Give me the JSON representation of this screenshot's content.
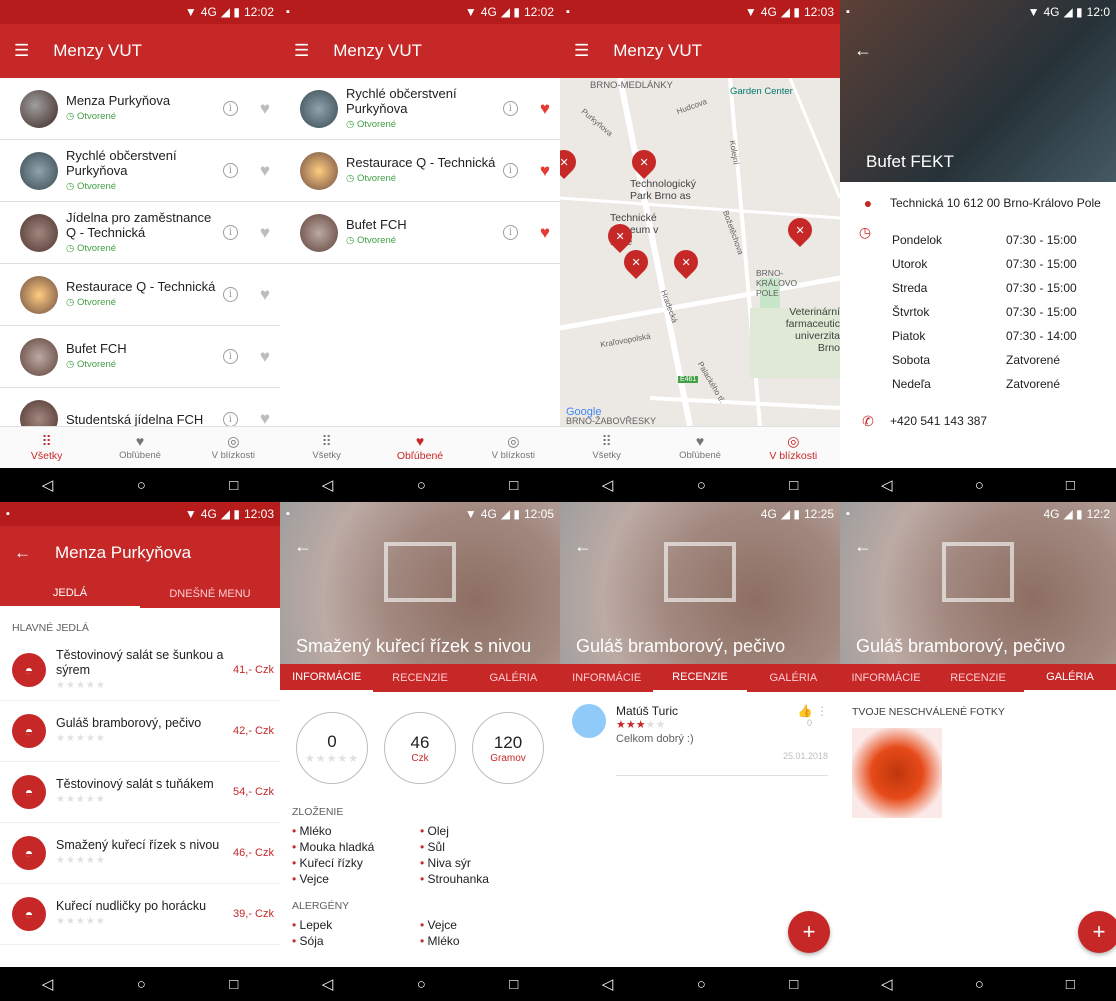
{
  "status": {
    "time1": "12:02",
    "time2": "12:02",
    "time3": "12:03",
    "time4": "12:0",
    "time5": "12:03",
    "time6": "12:05",
    "time7": "12:25",
    "time8": "12:2",
    "net": "4G"
  },
  "app_title": "Menzy VUT",
  "bottom_nav": {
    "all": "Všetky",
    "fav": "Obľúbené",
    "near": "V blízkosti"
  },
  "list_all": [
    {
      "name": "Menza Purkyňova",
      "status": "Otvorené"
    },
    {
      "name": "Rychlé občerstvení Purkyňova",
      "status": "Otvorené"
    },
    {
      "name": "Jídelna pro zaměstnance Q - Technická",
      "status": "Otvorené"
    },
    {
      "name": "Restaurace Q - Technická",
      "status": "Otvorené"
    },
    {
      "name": "Bufet FCH",
      "status": "Otvorené"
    },
    {
      "name": "Studentská jídelna FCH",
      "status": ""
    }
  ],
  "list_fav": [
    {
      "name": "Rychlé občerstvení Purkyňova",
      "status": "Otvorené"
    },
    {
      "name": "Restaurace Q - Technická",
      "status": "Otvorené"
    },
    {
      "name": "Bufet FCH",
      "status": "Otvorené"
    }
  ],
  "map": {
    "labels": [
      "BRNO-MEDLÁNKY",
      "Garden Center",
      "Technologický Park Brno as",
      "Technické muzeum v Brně",
      "Veterinární farmaceutic univerzita Brno",
      "BRNO-KRÁLOVO POLE",
      "Google",
      "BRNO-ŽABOVŘESKY",
      "Purkyňova",
      "Hudcova",
      "Kolejní",
      "Božetěchova",
      "Hradecká",
      "Palackého tř.",
      "Kraľovopolská",
      "E461"
    ]
  },
  "detail": {
    "name": "Bufet FEKT",
    "address": "Technická 10 612 00 Brno-Královo Pole",
    "hours": [
      {
        "day": "Pondelok",
        "time": "07:30 - 15:00"
      },
      {
        "day": "Utorok",
        "time": "07:30 - 15:00"
      },
      {
        "day": "Streda",
        "time": "07:30 - 15:00"
      },
      {
        "day": "Štvrtok",
        "time": "07:30 - 15:00"
      },
      {
        "day": "Piatok",
        "time": "07:30 - 14:00"
      },
      {
        "day": "Sobota",
        "time": "Zatvorené"
      },
      {
        "day": "Nedeľa",
        "time": "Zatvorené"
      }
    ],
    "phone": "+420 541 143 387"
  },
  "menza": {
    "title": "Menza Purkyňova",
    "tab_meals": "JEDLÁ",
    "tab_today": "DNEŠNÉ MENU",
    "section": "HLAVNÉ JEDLÁ",
    "meals": [
      {
        "name": "Těstovinový salát se šunkou a sýrem",
        "price": "41,- Czk"
      },
      {
        "name": "Guláš bramborový, pečivo",
        "price": "42,- Czk"
      },
      {
        "name": "Těstovinový salát s tuňákem",
        "price": "54,- Czk"
      },
      {
        "name": "Smažený kuřecí řízek s nivou",
        "price": "46,- Czk"
      },
      {
        "name": "Kuřecí nudličky po horácku",
        "price": "39,- Czk"
      }
    ]
  },
  "food_tabs": {
    "info": "INFORMÁCIE",
    "reviews": "RECENZIE",
    "gallery": "GALÉRIA"
  },
  "food1": {
    "title": "Smažený kuřecí řízek s nivou",
    "rating": "0",
    "price": "46",
    "price_unit": "Czk",
    "weight": "120",
    "weight_unit": "Gramov",
    "composition_title": "ZLOŽENIE",
    "composition": [
      "Mléko",
      "Olej",
      "Mouka hladká",
      "Sůl",
      "Kuřecí řízky",
      "Niva sýr",
      "Vejce",
      "Strouhanka"
    ],
    "allergens_title": "ALERGÉNY",
    "allergens": [
      "Lepek",
      "Vejce",
      "Sója",
      "Mléko"
    ]
  },
  "food2": {
    "title": "Guláš bramborový, pečivo"
  },
  "review": {
    "author": "Matúš Turic",
    "text": "Celkom dobrý :)",
    "date": "25.01.2018",
    "likes": "0",
    "stars": 3
  },
  "food3": {
    "title": "Guláš bramborový, pečivo",
    "gallery_title": "TVOJE NESCHVÁLENÉ FOTKY"
  },
  "fab": "+"
}
